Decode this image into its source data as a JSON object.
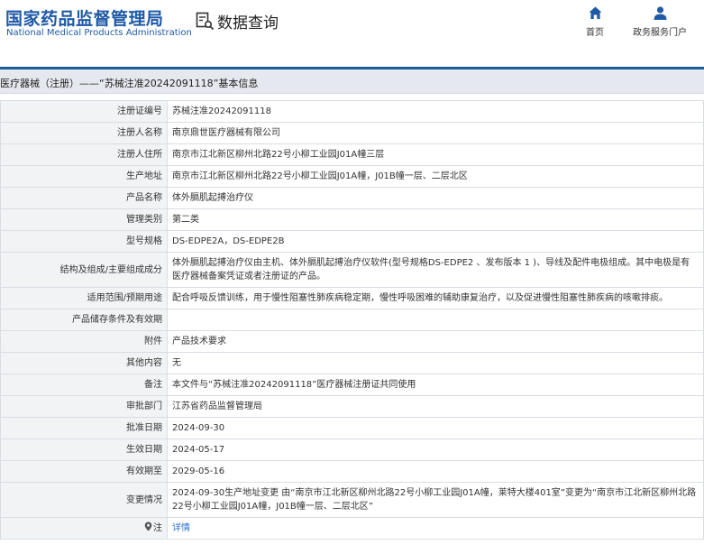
{
  "header": {
    "logo_cn": "国家药品监督管理局",
    "logo_en": "National Medical Products Administration",
    "data_query": "数据查询",
    "nav": {
      "home": "首页",
      "gov": "政务服务门户"
    }
  },
  "breadcrumb": "医疗器械（注册）——“苏械注准20242091118”基本信息",
  "rows": [
    {
      "label": "注册证编号",
      "value": "苏械注准20242091118"
    },
    {
      "label": "注册人名称",
      "value": "南京鼎世医疗器械有限公司"
    },
    {
      "label": "注册人住所",
      "value": "南京市江北新区柳州北路22号小柳工业园J01A幢三层"
    },
    {
      "label": "生产地址",
      "value": "南京市江北新区柳州北路22号小柳工业园J01A幢，J01B幢一层、二层北区"
    },
    {
      "label": "产品名称",
      "value": "体外膈肌起搏治疗仪"
    },
    {
      "label": "管理类别",
      "value": "第二类"
    },
    {
      "label": "型号规格",
      "value": "DS-EDPE2A，DS-EDPE2B"
    },
    {
      "label": "结构及组成/主要组成成分",
      "value": "体外膈肌起搏治疗仪由主机、体外膈肌起搏治疗仪软件(型号规格DS-EDPE2 、发布版本 1 )、导线及配件电极组成。其中电极是有医疗器械备案凭证或者注册证的产品。"
    },
    {
      "label": "适用范围/预期用途",
      "value": "配合呼吸反馈训练，用于慢性阻塞性肺疾病稳定期，慢性呼吸困难的辅助康复治疗，以及促进慢性阻塞性肺疾病的咳嗽排痰。"
    },
    {
      "label": "产品储存条件及有效期",
      "value": ""
    },
    {
      "label": "附件",
      "value": "产品技术要求"
    },
    {
      "label": "其他内容",
      "value": "无"
    },
    {
      "label": "备注",
      "value": "本文件与“苏械注准20242091118”医疗器械注册证共同使用"
    },
    {
      "label": "审批部门",
      "value": "江苏省药品监督管理局"
    },
    {
      "label": "批准日期",
      "value": "2024-09-30"
    },
    {
      "label": "生效日期",
      "value": "2024-05-17"
    },
    {
      "label": "有效期至",
      "value": "2029-05-16"
    },
    {
      "label": "变更情况",
      "value": "2024-09-30生产地址变更 由“南京市江北新区柳州北路22号小柳工业园J01A幢，莱特大楼401室”变更为“南京市江北新区柳州北路22号小柳工业园J01A幢，J01B幢一层、二层北区”"
    }
  ],
  "note_row": {
    "label": "注",
    "link": "详情",
    "icon": "location-pin-icon"
  },
  "colors": {
    "brand": "#1f5aa6",
    "bar": "#1a5b98",
    "link": "#2d6fd3"
  }
}
